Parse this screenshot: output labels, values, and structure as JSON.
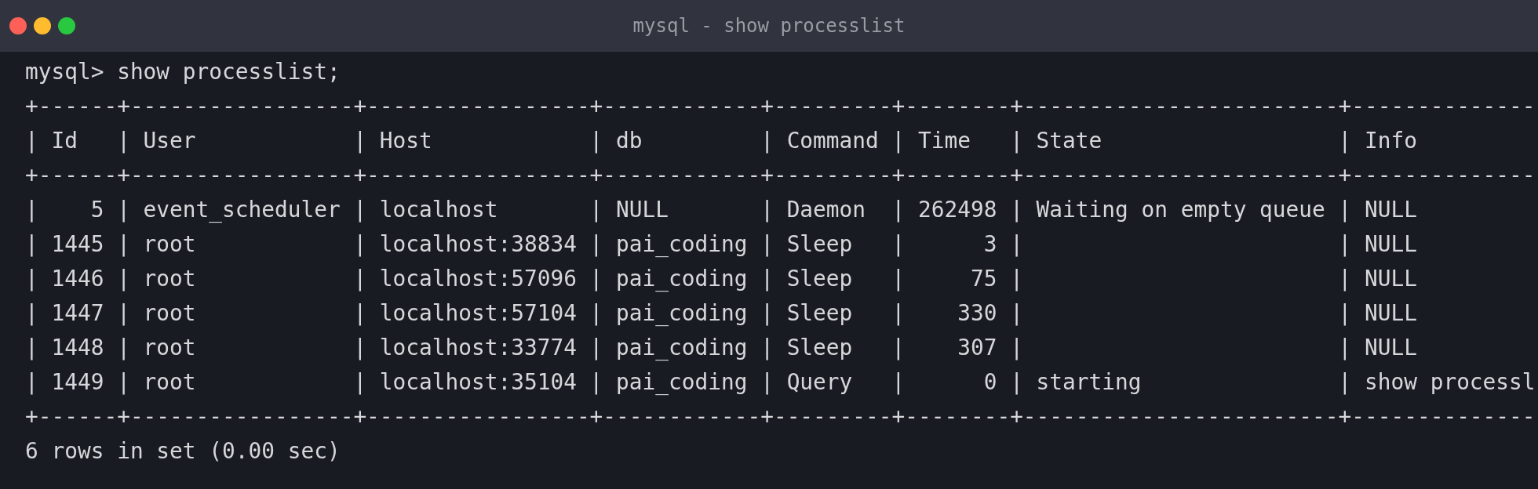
{
  "window": {
    "title": "mysql - show processlist"
  },
  "lines": [
    "mysql> show processlist;",
    "+------+-----------------+-----------------+------------+---------+--------+------------------------+--------------",
    "| Id   | User            | Host            | db         | Command | Time   | State                  | Info",
    "+------+-----------------+-----------------+------------+---------+--------+------------------------+--------------",
    "|    5 | event_scheduler | localhost       | NULL       | Daemon  | 262498 | Waiting on empty queue | NULL",
    "| 1445 | root            | localhost:38834 | pai_coding | Sleep   |      3 |                        | NULL",
    "| 1446 | root            | localhost:57096 | pai_coding | Sleep   |     75 |                        | NULL",
    "| 1447 | root            | localhost:57104 | pai_coding | Sleep   |    330 |                        | NULL",
    "| 1448 | root            | localhost:33774 | pai_coding | Sleep   |    307 |                        | NULL",
    "| 1449 | root            | localhost:35104 | pai_coding | Query   |      0 | starting               | show processl",
    "+------+-----------------+-----------------+------------+---------+--------+------------------------+--------------",
    "6 rows in set (0.00 sec)"
  ]
}
